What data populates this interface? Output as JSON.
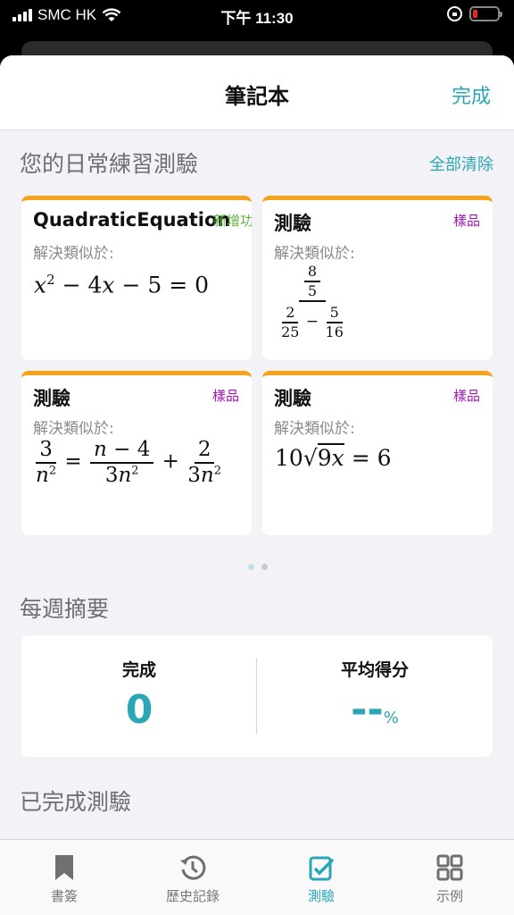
{
  "status": {
    "carrier": "SMC HK",
    "time": "下午 11:30"
  },
  "nav": {
    "title": "筆記本",
    "done": "完成"
  },
  "daily": {
    "heading": "您的日常練習測驗",
    "clear_all": "全部清除",
    "cards": [
      {
        "title": "QuadraticEquation",
        "tag": "新增功",
        "subtitle": "解決類似於:",
        "equation": "x² − 4x − 5 = 0"
      },
      {
        "title": "測驗",
        "tag": "樣品",
        "subtitle": "解決類似於:",
        "equation": "(8/5) / (2/25 − 5/16)"
      },
      {
        "title": "測驗",
        "tag": "樣品",
        "subtitle": "解決類似於:",
        "equation": "3/n² = (n − 4)/(3n²) + 2/(3n²)"
      },
      {
        "title": "測驗",
        "tag": "樣品",
        "subtitle": "解決類似於:",
        "equation": "10√(9x) = 6"
      }
    ]
  },
  "weekly": {
    "heading": "每週摘要",
    "completed_label": "完成",
    "completed_value": "0",
    "avg_label": "平均得分",
    "avg_value": "--",
    "avg_unit": "%"
  },
  "completed": {
    "heading": "已完成測驗"
  },
  "tabs": [
    {
      "label": "書簽",
      "icon": "bookmark-icon"
    },
    {
      "label": "歷史記錄",
      "icon": "history-icon"
    },
    {
      "label": "測驗",
      "icon": "quiz-icon",
      "active": true
    },
    {
      "label": "示例",
      "icon": "grid-icon"
    }
  ],
  "colors": {
    "accent": "#29a7b7",
    "card_top": "#f7a21b",
    "tag_sample": "#a312b5",
    "tag_new": "#5fb83c"
  }
}
